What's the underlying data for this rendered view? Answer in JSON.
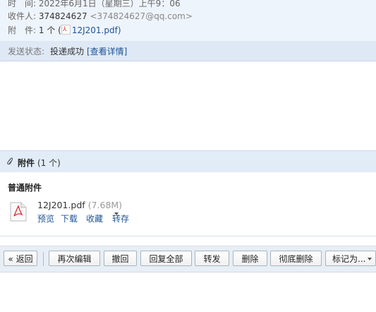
{
  "header": {
    "time_label": "时　间:",
    "time_value": "2022年6月1日（星期三）上午9：06",
    "recipient_label": "收件人:",
    "recipient_name": "374824627",
    "recipient_addr": "<374824627@qq.com>",
    "attachment_label": "附　件:",
    "attachment_count": "1 个 (",
    "attachment_file": "12J201.pdf",
    "attachment_close": ")"
  },
  "status": {
    "label": "发送状态:",
    "value": "投递成功",
    "link": "[查看详情]"
  },
  "attachments": {
    "title": "附件",
    "count": "(1 个)",
    "section": "普通附件",
    "file": {
      "name": "12J201.pdf",
      "size": "(7.68M)",
      "actions": [
        "预览",
        "下载",
        "收藏",
        "转存"
      ]
    }
  },
  "toolbar": {
    "back": "« 返回",
    "buttons": [
      "再次编辑",
      "撤回",
      "回复全部",
      "转发",
      "删除",
      "彻底删除",
      "标记为..."
    ]
  },
  "colors": {
    "link": "#1e5494",
    "header_bg": "#eef4fb",
    "bar_bg": "#e2ecf7"
  }
}
